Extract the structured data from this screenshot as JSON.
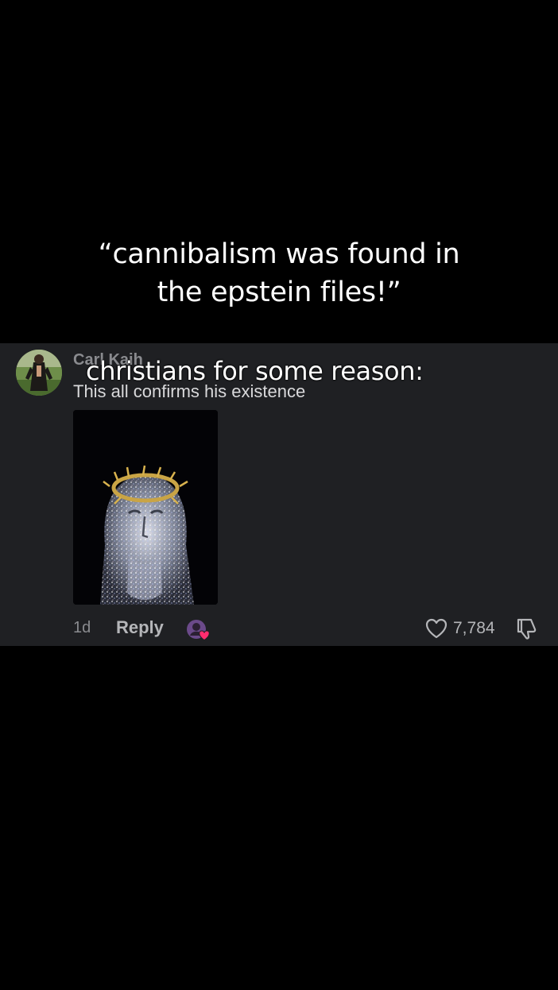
{
  "caption": {
    "line1": "“cannibalism was found in",
    "line2": "the epstein files!”",
    "overlay": "christians for some reason:"
  },
  "comment": {
    "username": "Carl Kaih",
    "text": "This all confirms his existence",
    "time": "1d",
    "reply_label": "Reply",
    "like_count": "7,784",
    "image_icon": "jeweled-crown-of-thorns-portrait"
  },
  "colors": {
    "card_background": "#1f2023",
    "page_background": "#000000",
    "creator_badge": "#ff2d6f"
  }
}
